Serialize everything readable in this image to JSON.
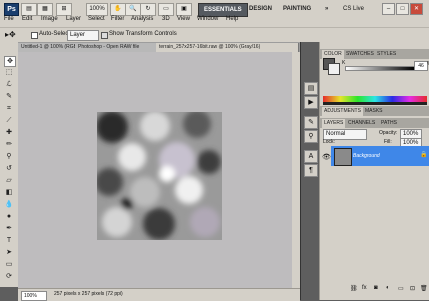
{
  "app": {
    "logo": "Ps",
    "zoom": "100%"
  },
  "menu": [
    "File",
    "Edit",
    "Image",
    "Layer",
    "Select",
    "Filter",
    "Analysis",
    "3D",
    "View",
    "Window",
    "Help"
  ],
  "workspace": {
    "essentials": "ESSENTIALS",
    "design": "DESIGN",
    "painting": "PAINTING",
    "more": "»",
    "cs_live": "CS Live"
  },
  "window_controls": {
    "minimize": "–",
    "maximize": "□",
    "close": "✕"
  },
  "options": {
    "auto_select": "Auto-Select:",
    "auto_select_value": "Layer",
    "show_transform": "Show Transform Controls"
  },
  "tabs": [
    {
      "label": "Untitled-1 @ 100% (RGB/8) ×"
    },
    {
      "label": "Photoshop - Open RAW file"
    },
    {
      "label": "terrain_257x257-16bit.raw @ 100% (Gray/16)"
    }
  ],
  "status": {
    "zoom": "100%",
    "doc_info": "257 pixels x 257 pixels (72 ppi)"
  },
  "colorpanel": {
    "tabs": [
      "COLOR",
      "SWATCHES",
      "STYLES"
    ],
    "k_label": "K",
    "k_value": "46",
    "k_unit": "%"
  },
  "adjustments": {
    "tabs": [
      "ADJUSTMENTS",
      "MASKS"
    ]
  },
  "layers": {
    "tabs": [
      "LAYERS",
      "CHANNELS",
      "PATHS"
    ],
    "blend_mode": "Normal",
    "opacity_label": "Opacity:",
    "opacity_value": "100%",
    "lock_label": "Lock:",
    "fill_label": "Fill:",
    "fill_value": "100%",
    "items": [
      {
        "name": "Background",
        "visible": true,
        "locked": true
      }
    ]
  },
  "colors": {
    "accent": "#3f87e8",
    "panel_bg": "#d4d0c8",
    "canvas_bg": "#bebcbe",
    "dark_chrome": "#5e5e5e"
  }
}
